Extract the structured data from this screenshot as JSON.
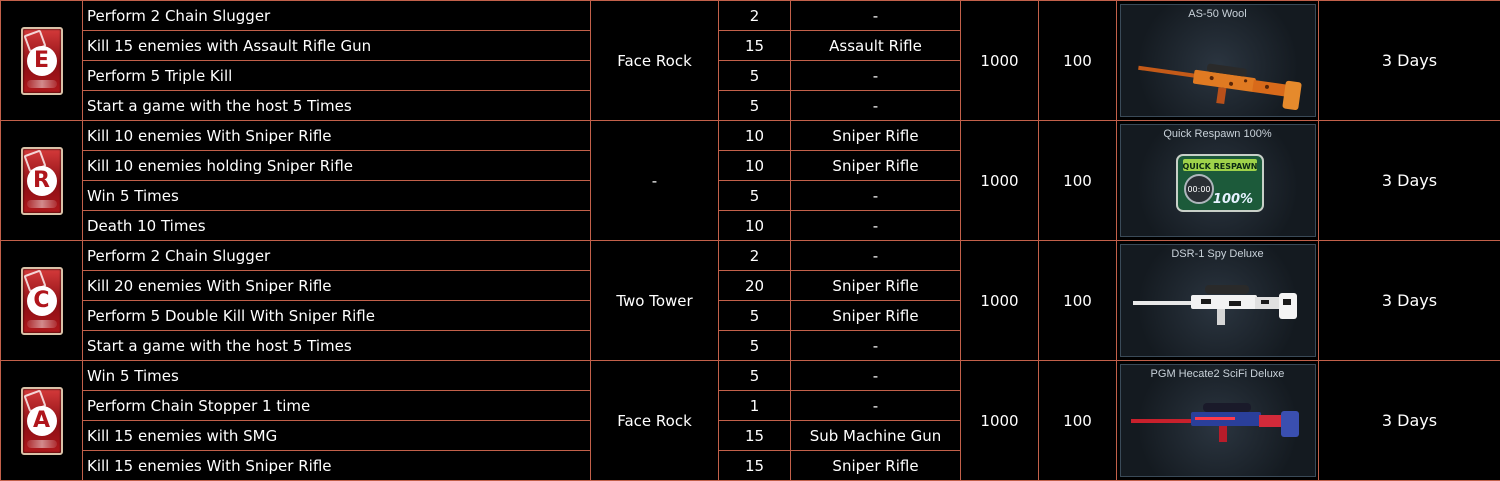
{
  "groups": [
    {
      "letter": "E",
      "map": "Face Rock",
      "exp": "1000",
      "points": "100",
      "reward_name": "AS-50 Wool",
      "reward_icon": "orange-camo-sniper-rifle",
      "duration": "3 Days",
      "tasks": [
        {
          "task": "Perform 2 Chain Slugger",
          "count": "2",
          "weapon": "-"
        },
        {
          "task": "Kill 15 enemies with Assault Rifle Gun",
          "count": "15",
          "weapon": "Assault Rifle"
        },
        {
          "task": "Perform 5 Triple Kill",
          "count": "5",
          "weapon": "-"
        },
        {
          "task": "Start a game with the host 5 Times",
          "count": "5",
          "weapon": "-"
        }
      ]
    },
    {
      "letter": "R",
      "map": "-",
      "exp": "1000",
      "points": "100",
      "reward_name": "Quick Respawn 100%",
      "reward_icon": "quick-respawn-badge",
      "reward_badge_title": "QUICK RESPAWN",
      "reward_badge_time": "00:00",
      "reward_badge_pct": "100%",
      "duration": "3 Days",
      "tasks": [
        {
          "task": "Kill 10 enemies With Sniper Rifle",
          "count": "10",
          "weapon": "Sniper Rifle"
        },
        {
          "task": "Kill 10 enemies holding Sniper Rifle",
          "count": "10",
          "weapon": "Sniper Rifle"
        },
        {
          "task": "Win 5 Times",
          "count": "5",
          "weapon": "-"
        },
        {
          "task": "Death 10 Times",
          "count": "10",
          "weapon": "-"
        }
      ]
    },
    {
      "letter": "C",
      "map": "Two Tower",
      "exp": "1000",
      "points": "100",
      "reward_name": "DSR-1 Spy Deluxe",
      "reward_icon": "white-camo-sniper-rifle",
      "duration": "3 Days",
      "tasks": [
        {
          "task": "Perform 2 Chain Slugger",
          "count": "2",
          "weapon": "-"
        },
        {
          "task": "Kill 20 enemies With Sniper Rifle",
          "count": "20",
          "weapon": "Sniper Rifle"
        },
        {
          "task": "Perform 5 Double Kill With Sniper Rifle",
          "count": "5",
          "weapon": "Sniper Rifle"
        },
        {
          "task": "Start a game with the host 5 Times",
          "count": "5",
          "weapon": "-"
        }
      ]
    },
    {
      "letter": "A",
      "map": "Face Rock",
      "exp": "1000",
      "points": "100",
      "reward_name": "PGM Hecate2 SciFi Deluxe",
      "reward_icon": "red-blue-sniper-rifle",
      "duration": "3 Days",
      "tasks": [
        {
          "task": "Win 5 Times",
          "count": "5",
          "weapon": "-"
        },
        {
          "task": "Perform Chain Stopper 1 time",
          "count": "1",
          "weapon": "-"
        },
        {
          "task": "Kill 15 enemies with SMG",
          "count": "15",
          "weapon": "Sub Machine Gun"
        },
        {
          "task": "Kill 15 enemies With Sniper Rifle",
          "count": "15",
          "weapon": "Sniper Rifle"
        }
      ]
    }
  ],
  "colors": {
    "border": "#c2604a",
    "card_red": "#b0161c",
    "background": "#000000",
    "text": "#ffffff"
  }
}
